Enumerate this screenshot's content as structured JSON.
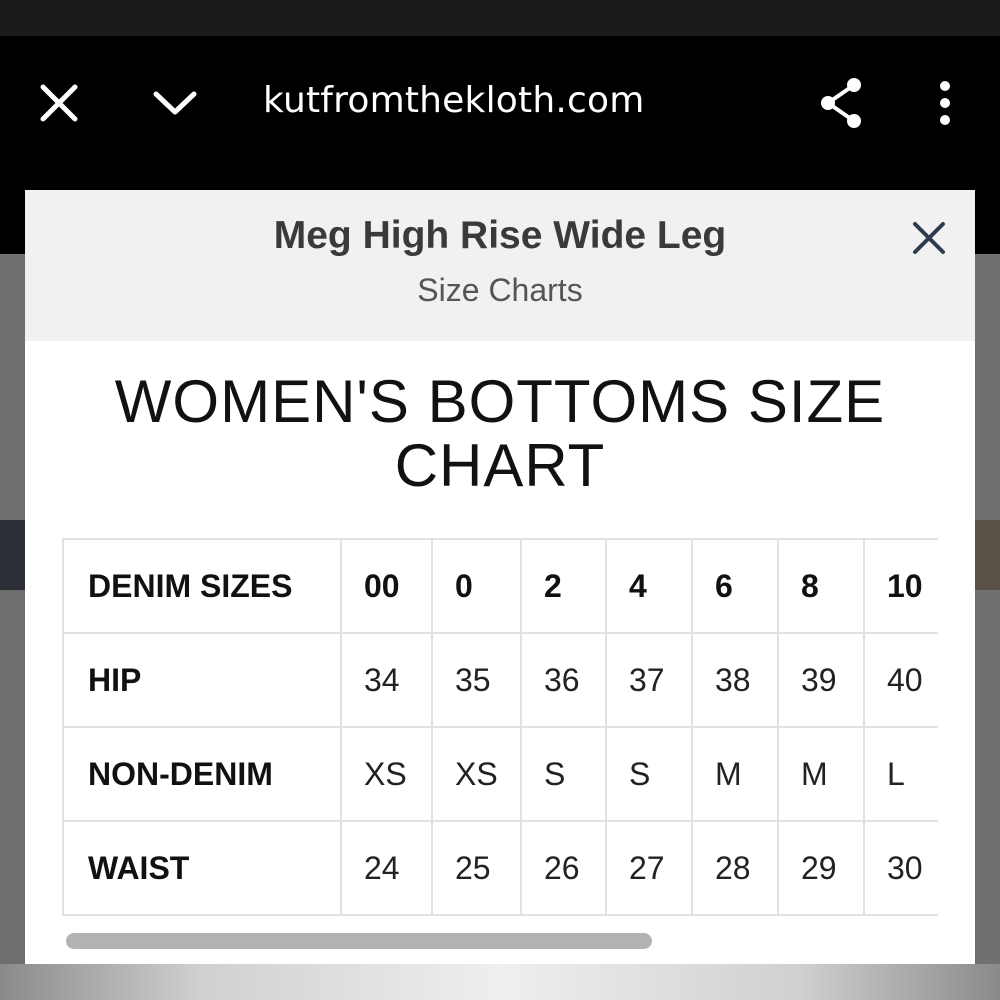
{
  "browser": {
    "url": "kutfromthekloth.com"
  },
  "modal": {
    "title": "Meg High Rise Wide Leg",
    "subtitle": "Size Charts"
  },
  "chart": {
    "title": "WOMEN'S BOTTOMS SIZE CHART",
    "rows": [
      {
        "label": "DENIM SIZES",
        "cells": [
          "00",
          "0",
          "2",
          "4",
          "6",
          "8",
          "10"
        ]
      },
      {
        "label": "HIP",
        "cells": [
          "34",
          "35",
          "36",
          "37",
          "38",
          "39",
          "40"
        ]
      },
      {
        "label": "NON-DENIM",
        "cells": [
          "XS",
          "XS",
          "S",
          "S",
          "M",
          "M",
          "L"
        ]
      },
      {
        "label": "WAIST",
        "cells": [
          "24",
          "25",
          "26",
          "27",
          "28",
          "29",
          "30"
        ]
      }
    ]
  },
  "icons": {
    "browser_close": "close-icon",
    "minimize": "chevron-down-icon",
    "share": "share-icon",
    "more": "more-vertical-icon",
    "modal_close": "close-icon"
  },
  "colors": {
    "browser_bar": "#000000",
    "modal_header": "#f1f1f1",
    "table_border": "#e2e2e2",
    "scrollbar": "#b3b3b3"
  }
}
